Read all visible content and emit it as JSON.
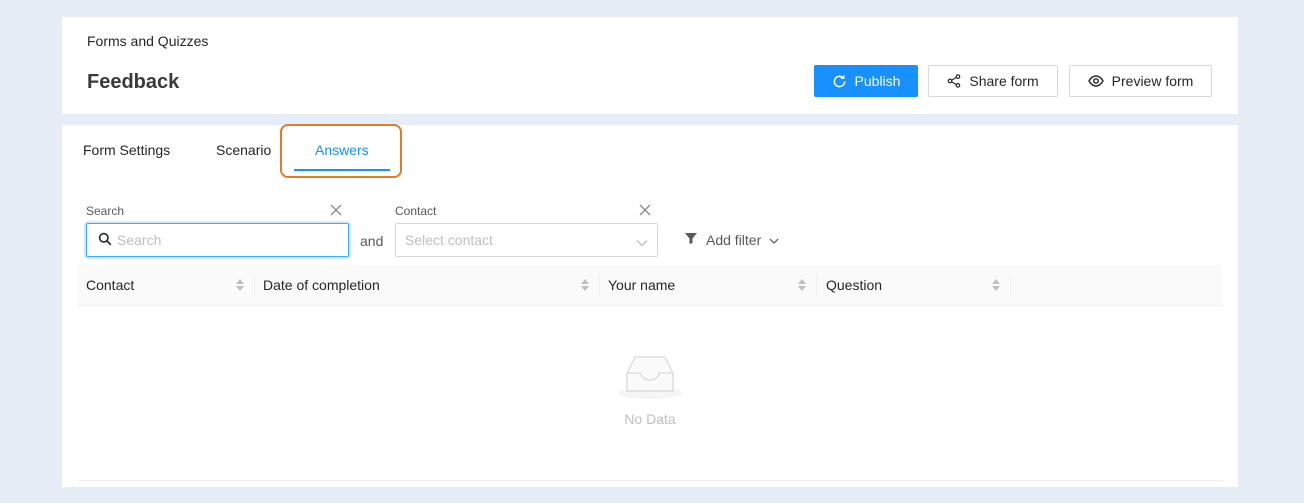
{
  "header": {
    "breadcrumb": "Forms and Quizzes",
    "title": "Feedback",
    "buttons": {
      "publish": "Publish",
      "share": "Share form",
      "preview": "Preview form"
    }
  },
  "tabs": [
    {
      "label": "Form Settings",
      "active": false
    },
    {
      "label": "Scenario",
      "active": false
    },
    {
      "label": "Answers",
      "active": true
    }
  ],
  "filters": {
    "search": {
      "label": "Search",
      "placeholder": "Search",
      "value": ""
    },
    "conjunction": "and",
    "contact": {
      "label": "Contact",
      "placeholder": "Select contact"
    },
    "add_filter": "Add filter"
  },
  "table": {
    "columns": [
      "Contact",
      "Date of completion",
      "Your name",
      "Question"
    ],
    "empty_text": "No Data"
  },
  "colors": {
    "primary": "#1890ff",
    "highlight": "#e07b2a",
    "background": "#e7edf6"
  }
}
